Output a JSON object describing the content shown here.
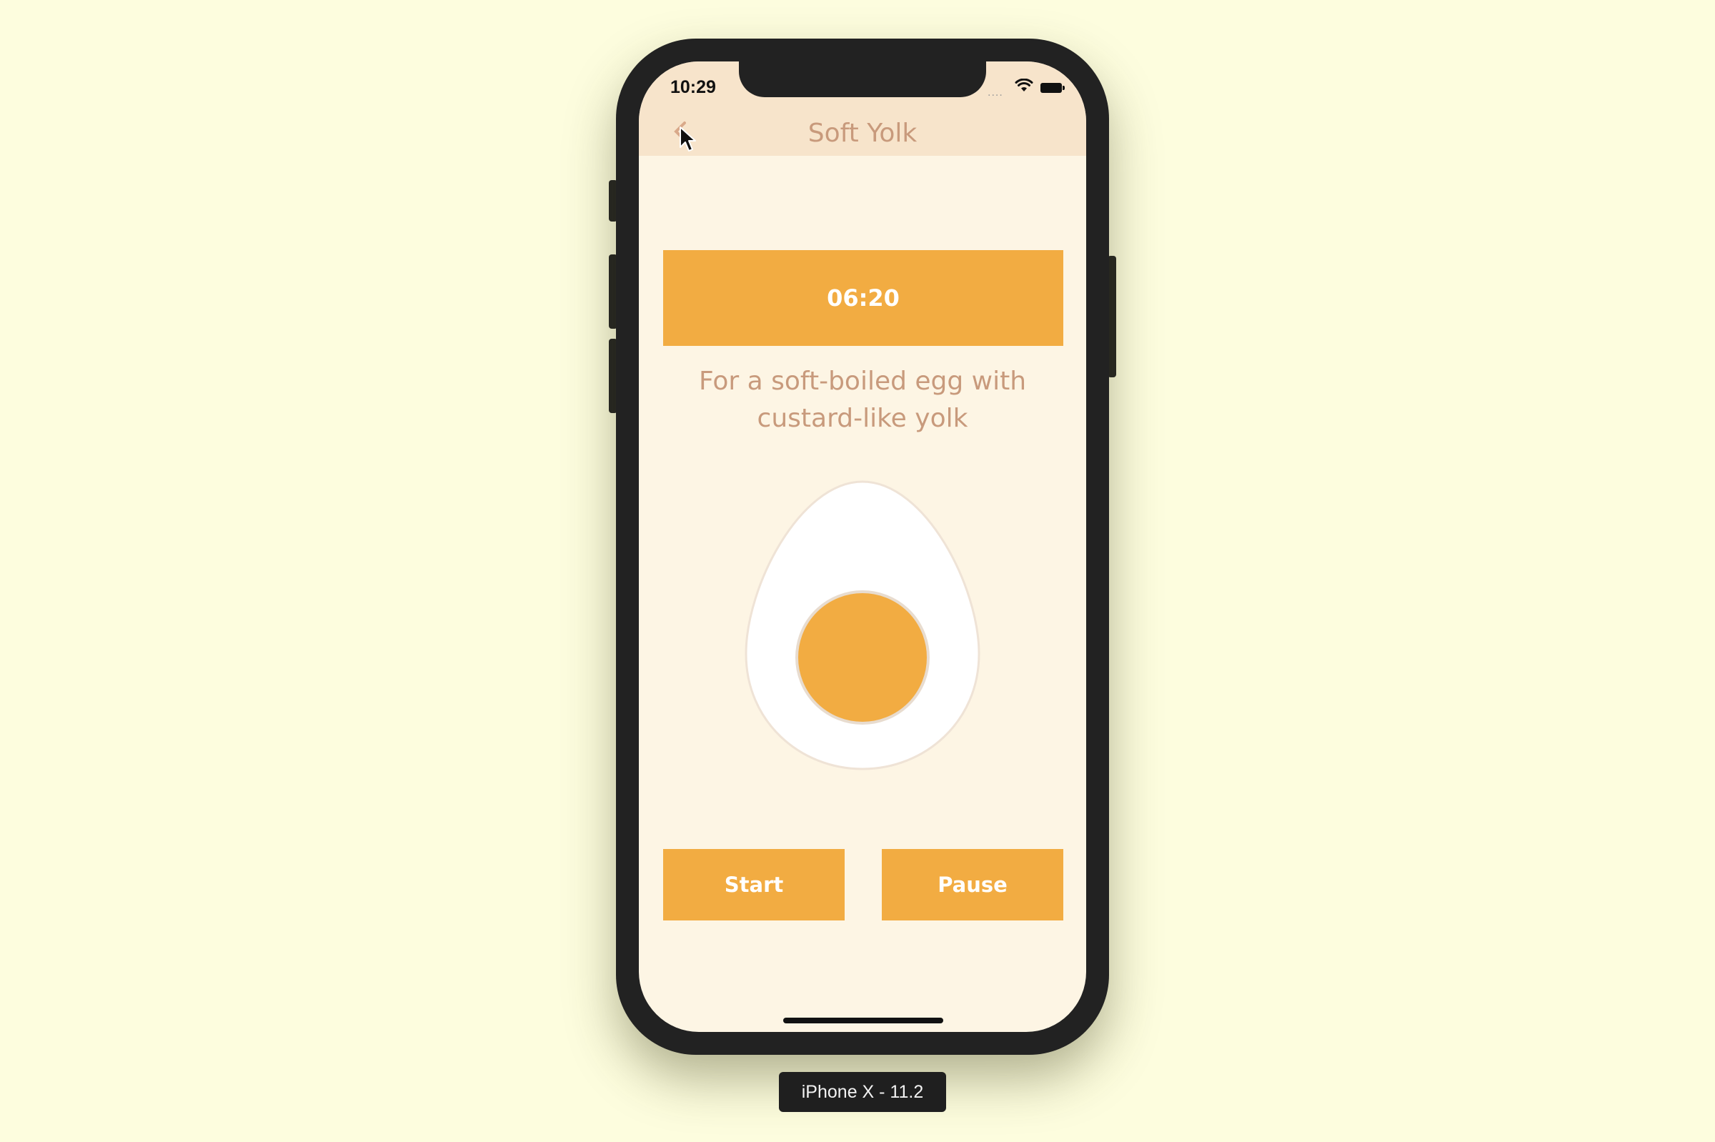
{
  "status_bar": {
    "time": "10:29"
  },
  "nav": {
    "title": "Soft Yolk",
    "back_icon": "chevron-left-icon"
  },
  "timer": {
    "display": "06:20"
  },
  "description": {
    "line1": "For a soft-boiled egg with",
    "line2": "custard-like yolk"
  },
  "buttons": {
    "start_label": "Start",
    "pause_label": "Pause"
  },
  "simulator": {
    "device_label": "iPhone X - 11.2"
  },
  "colors": {
    "background": "#fdfdde",
    "screen_background": "#fdf5e4",
    "nav_background": "#f7e4cb",
    "accent": "#f2ac42",
    "title_text": "#c89a7c",
    "egg_white": "#ffffff"
  }
}
